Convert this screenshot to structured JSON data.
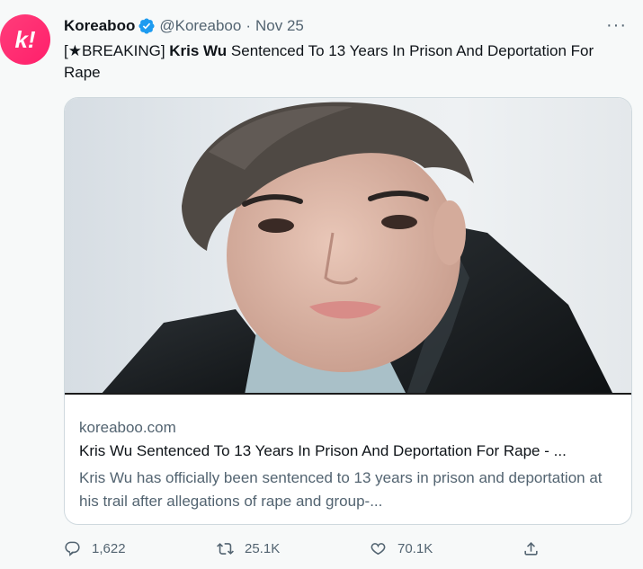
{
  "author": {
    "avatar_text": "k!",
    "name": "Koreaboo",
    "handle": "@Koreaboo",
    "separator": "·",
    "date": "Nov 25",
    "brand_color": "#ff2d75",
    "verified_color": "#1d9bf0"
  },
  "more_label": "···",
  "tweet": {
    "prefix": "[★BREAKING] ",
    "bold": "Kris Wu",
    "rest": " Sentenced To 13 Years In Prison And Deportation For Rape"
  },
  "card": {
    "domain": "koreaboo.com",
    "title": "Kris Wu Sentenced To 13 Years In Prison And Deportation For Rape - ...",
    "description": "Kris Wu has officially been sentenced to 13 years in prison and deportation at his trail after allegations of rape and group-..."
  },
  "actions": {
    "reply_count": "1,622",
    "retweet_count": "25.1K",
    "like_count": "70.1K"
  }
}
